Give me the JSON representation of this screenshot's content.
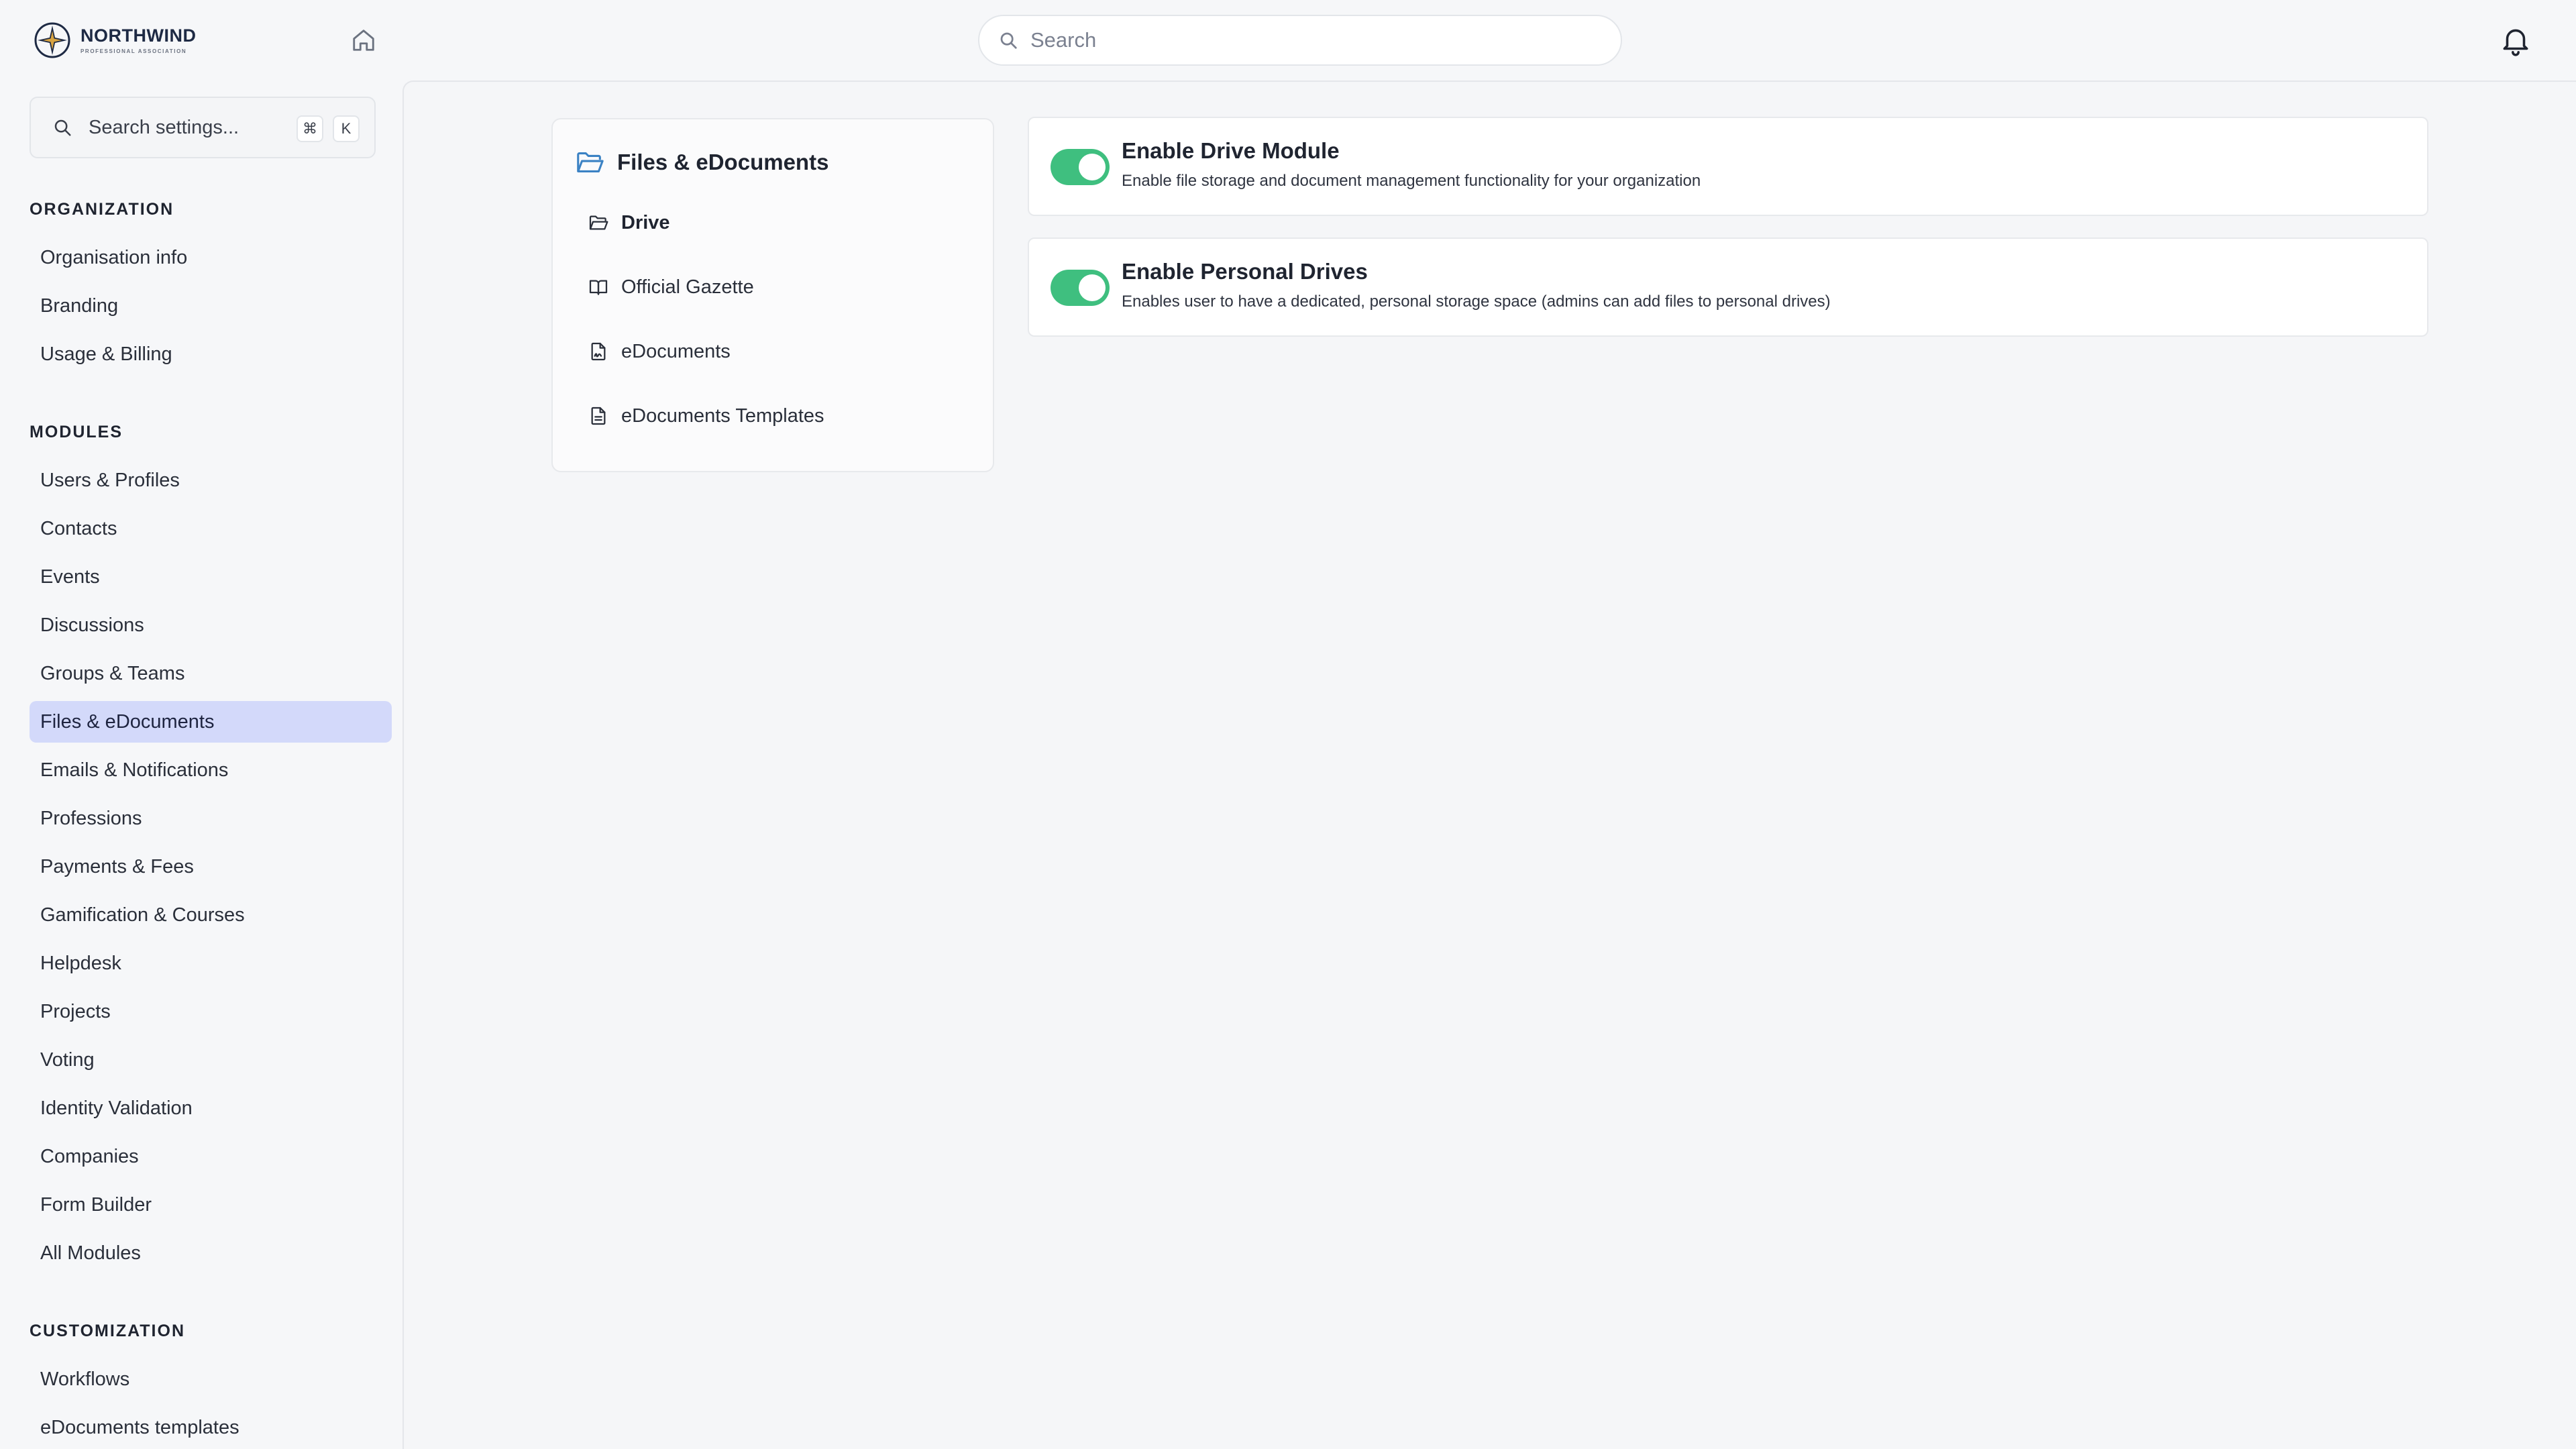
{
  "brand": {
    "name": "NORTHWIND",
    "tagline": "PROFESSIONAL ASSOCIATION",
    "accent_color": "#1e2a44",
    "star_color": "#d9a441"
  },
  "topbar": {
    "search_placeholder": "Search"
  },
  "sidebar": {
    "search_placeholder": "Search settings...",
    "shortcut_cmd": "⌘",
    "shortcut_key": "K",
    "sections": {
      "organization": {
        "title": "ORGANIZATION",
        "items": [
          "Organisation info",
          "Branding",
          "Usage & Billing"
        ]
      },
      "modules": {
        "title": "MODULES",
        "items": [
          "Users & Profiles",
          "Contacts",
          "Events",
          "Discussions",
          "Groups & Teams",
          "Files & eDocuments",
          "Emails & Notifications",
          "Professions",
          "Payments & Fees",
          "Gamification & Courses",
          "Helpdesk",
          "Projects",
          "Voting",
          "Identity Validation",
          "Companies",
          "Form Builder",
          "All Modules"
        ]
      },
      "customization": {
        "title": "CUSTOMIZATION",
        "items": [
          "Workflows",
          "eDocuments templates"
        ]
      }
    },
    "active_item": "Files & eDocuments",
    "active_color": "#d3d9fa"
  },
  "subnav": {
    "title": "Files & eDocuments",
    "items": [
      {
        "label": "Drive",
        "icon": "folder-icon",
        "active": true
      },
      {
        "label": "Official Gazette",
        "icon": "book-open-icon",
        "active": false
      },
      {
        "label": "eDocuments",
        "icon": "file-signature-icon",
        "active": false
      },
      {
        "label": "eDocuments Templates",
        "icon": "file-text-icon",
        "active": false
      }
    ]
  },
  "settings": [
    {
      "title": "Enable Drive Module",
      "description": "Enable file storage and document management functionality for your organization",
      "enabled": true
    },
    {
      "title": "Enable Personal Drives",
      "description": "Enables user to have a dedicated, personal storage space (admins can add files to personal drives)",
      "enabled": true
    }
  ],
  "colors": {
    "toggle_on": "#3fbf7f",
    "folder_icon": "#3b82c4"
  }
}
